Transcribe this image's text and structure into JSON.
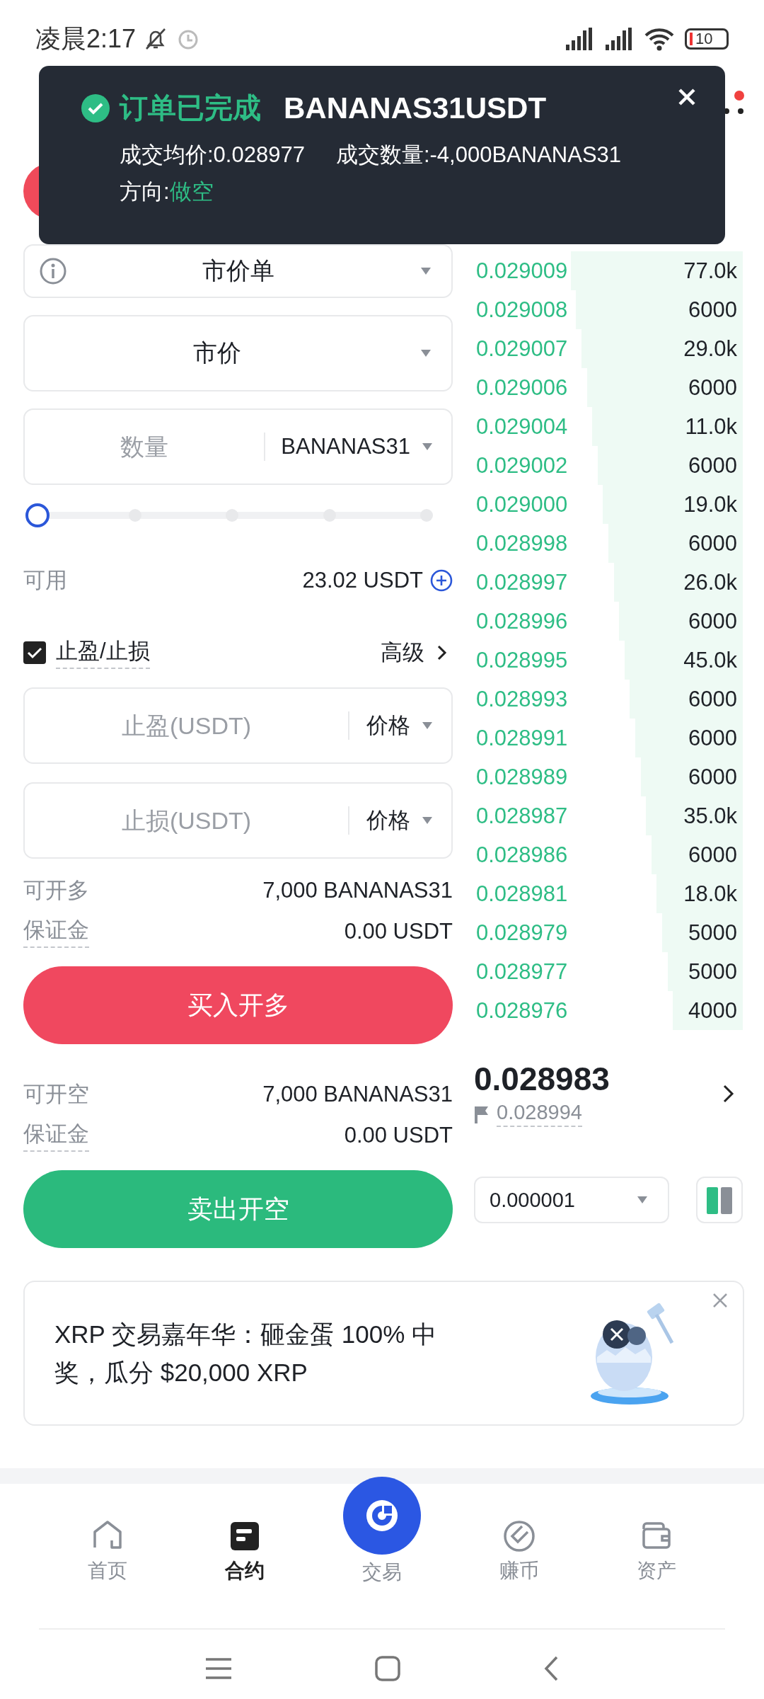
{
  "status_bar": {
    "time": "凌晨2:17",
    "battery": "10"
  },
  "toast": {
    "title": "订单已完成",
    "symbol": "BANANAS31USDT",
    "avg_price": "成交均价:0.028977",
    "filled_qty": "成交数量:-4,000BANANAS31",
    "direction_label": "方向:",
    "direction_value": "做空"
  },
  "order_form": {
    "order_type": "市价单",
    "price_mode": "市价",
    "quantity": {
      "placeholder": "数量",
      "unit": "BANANAS31"
    },
    "slider": {
      "level": 0
    },
    "available": {
      "label": "可用",
      "value": "23.02 USDT"
    },
    "tp_sl": {
      "label": "止盈/止损",
      "checked": true,
      "advanced": "高级"
    },
    "take_profit": {
      "placeholder": "止盈(USDT)",
      "mode": "价格"
    },
    "stop_loss": {
      "placeholder": "止损(USDT)",
      "mode": "价格"
    },
    "long": {
      "max_label": "可开多",
      "max_value": "7,000 BANANAS31",
      "margin_label": "保证金",
      "margin_value": "0.00 USDT",
      "button": "买入开多"
    },
    "short": {
      "max_label": "可开空",
      "max_value": "7,000 BANANAS31",
      "margin_label": "保证金",
      "margin_value": "0.00 USDT",
      "button": "卖出开空"
    }
  },
  "order_book": {
    "rows": [
      {
        "price": "0.029009",
        "amount": "77.0k"
      },
      {
        "price": "0.029008",
        "amount": "6000"
      },
      {
        "price": "0.029007",
        "amount": "29.0k"
      },
      {
        "price": "0.029006",
        "amount": "6000"
      },
      {
        "price": "0.029004",
        "amount": "11.0k"
      },
      {
        "price": "0.029002",
        "amount": "6000"
      },
      {
        "price": "0.029000",
        "amount": "19.0k"
      },
      {
        "price": "0.028998",
        "amount": "6000"
      },
      {
        "price": "0.028997",
        "amount": "26.0k"
      },
      {
        "price": "0.028996",
        "amount": "6000"
      },
      {
        "price": "0.028995",
        "amount": "45.0k"
      },
      {
        "price": "0.028993",
        "amount": "6000"
      },
      {
        "price": "0.028991",
        "amount": "6000"
      },
      {
        "price": "0.028989",
        "amount": "6000"
      },
      {
        "price": "0.028987",
        "amount": "35.0k"
      },
      {
        "price": "0.028986",
        "amount": "6000"
      },
      {
        "price": "0.028981",
        "amount": "18.0k"
      },
      {
        "price": "0.028979",
        "amount": "5000"
      },
      {
        "price": "0.028977",
        "amount": "5000"
      },
      {
        "price": "0.028976",
        "amount": "4000"
      }
    ],
    "last_price": "0.028983",
    "mark_price": "0.028994",
    "tick_size": "0.000001"
  },
  "banner": {
    "text": "XRP 交易嘉年华：砸金蛋 100% 中奖，瓜分 $20,000 XRP"
  },
  "bottom_nav": [
    {
      "label": "首页",
      "selected": false
    },
    {
      "label": "合约",
      "selected": true
    },
    {
      "label": "交易",
      "selected": false
    },
    {
      "label": "赚币",
      "selected": false
    },
    {
      "label": "资产",
      "selected": false
    }
  ]
}
